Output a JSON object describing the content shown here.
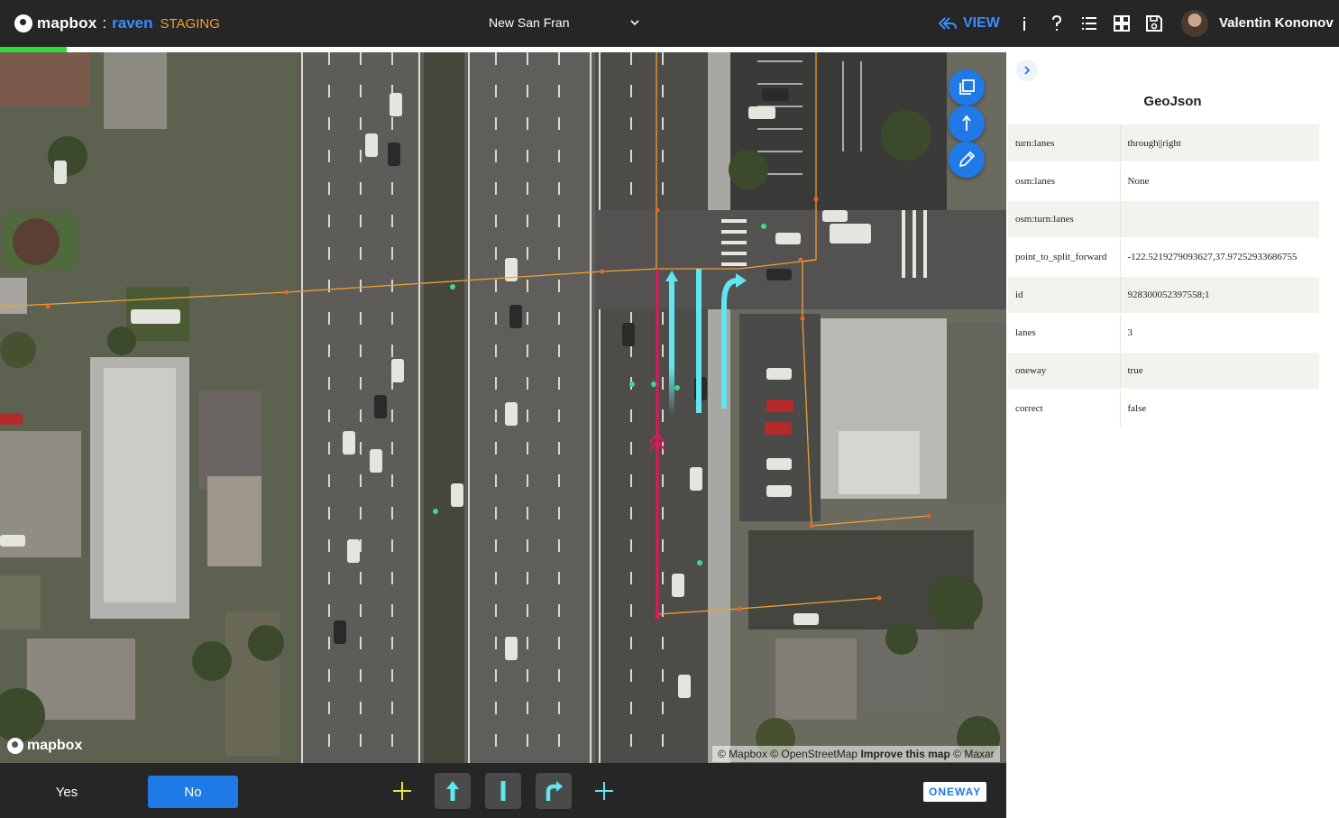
{
  "app": {
    "brand": "mapbox",
    "separator": ":",
    "product": "raven",
    "environment": "STAGING"
  },
  "header": {
    "region_selector": "New San Fran",
    "view_label": "VIEW",
    "user_name": "Valentin Kononov",
    "icons": [
      "info-icon",
      "help-icon",
      "list-icon",
      "grid-icon",
      "save-icon"
    ]
  },
  "progress": {
    "fraction": 0.05,
    "color": "#2ddc3c"
  },
  "map": {
    "logo": "mapbox",
    "attribution": {
      "mapbox": "© Mapbox",
      "osm": "© OpenStreetMap",
      "improve": "Improve this map",
      "maxar": "© Maxar"
    },
    "tools": [
      "layers-icon",
      "direction-icon",
      "edit-pencil-icon"
    ]
  },
  "panel": {
    "title": "GeoJson",
    "properties": [
      {
        "key": "turn:lanes",
        "value": "through||right"
      },
      {
        "key": "osm:lanes",
        "value": "None"
      },
      {
        "key": "osm:turn:lanes",
        "value": ""
      },
      {
        "key": "point_to_split_forward",
        "value": "-122.5219279093627,37.97252933686755"
      },
      {
        "key": "id",
        "value": "928300052397558;1"
      },
      {
        "key": "lanes",
        "value": "3"
      },
      {
        "key": "oneway",
        "value": "true"
      },
      {
        "key": "correct",
        "value": "false"
      }
    ]
  },
  "bottom": {
    "yes_label": "Yes",
    "no_label": "No",
    "oneway_badge": "ONEWAY",
    "lane_tools": [
      "add-lane-left-icon",
      "through-lane-icon",
      "none-lane-icon",
      "right-turn-lane-icon",
      "add-lane-right-icon"
    ]
  },
  "colors": {
    "accent": "#1f7ae8",
    "raven": "#3a8dff",
    "staging": "#f0a12c",
    "lane_arrow": "#5fe6f0",
    "road_line": "#e5145f",
    "plus_left": "#e8e33a"
  }
}
